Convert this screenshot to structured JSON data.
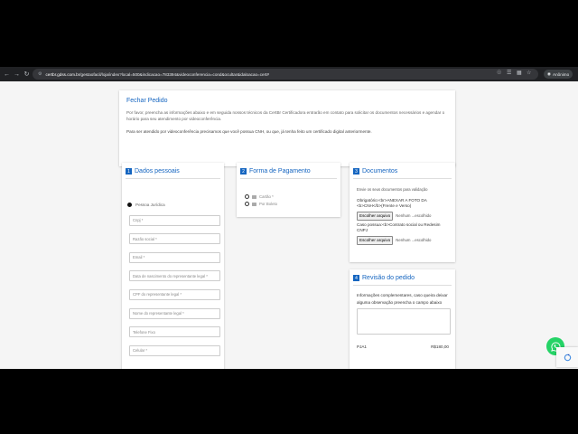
{
  "browser": {
    "url_host": "certbr.gdss.com.br",
    "url_path": "/gestaofacil/loja/index?local=500&indicacao=783394&videoconferencia=cond&ocultar&idaloacao=cert#",
    "profile_label": "Anônimo"
  },
  "header": {
    "title": "Fechar Pedido",
    "description": "Por favor, preencha as informações abaixo e em seguida nossos técnicos da CertBr Certificadora entrarão em contato para solicitar os documentos necessários e agendar o horário para seu atendimento por videoconferência.",
    "note": "Para ser atendido por videoconferência precisamos que você possua CNH, ou que, já tenha feito um certificado digital anteriormente."
  },
  "dados": {
    "num": "1",
    "title": "Dados pessoais",
    "person_type": "Pessoa Jurídica",
    "fields": [
      "Cnpj *",
      "Razão social *",
      "Email *",
      "Data de nascimento do representante legal *",
      "CPF do representante legal *",
      "Nome do representante legal *",
      "Telefone Fixo",
      "Celular *"
    ]
  },
  "pagamento": {
    "num": "2",
    "title": "Forma de Pagamento",
    "options": [
      "Cartão *",
      "Por Boleto"
    ]
  },
  "documentos": {
    "num": "3",
    "title": "Documentos",
    "intro": "Envie os seus documentos para validação",
    "req1": "Obrigatório:<br>ANEXAR A FOTO DA <b>CNH</b>(Frente e Verso)",
    "req2": "Caso possua:<b>Contrato social ou Redesim CNPJ",
    "file_button": "Escolher arquivo",
    "file_none": "Nenhum ...escolhido"
  },
  "revisao": {
    "num": "4",
    "title": "Revisão do pedido",
    "info": "Informações complementares, caso queira deixar alguma observação preencha o campo abaixo",
    "item_name": "PJA1",
    "item_price": "R$180,00"
  },
  "colors": {
    "accent": "#1565c0",
    "whatsapp": "#25d366"
  }
}
